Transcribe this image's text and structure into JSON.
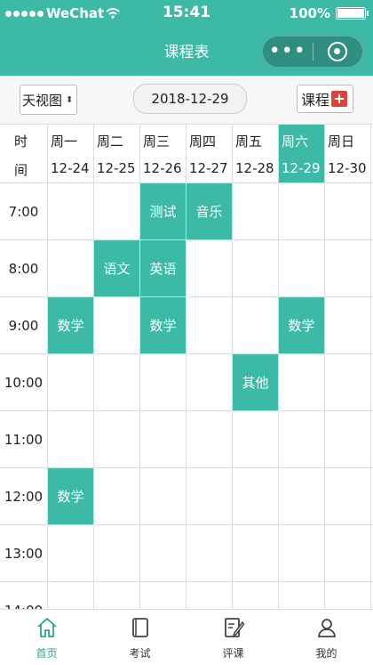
{
  "status": {
    "carrier": "WeChat",
    "time": "15:41",
    "battery": "100%"
  },
  "nav": {
    "title": "课程表"
  },
  "toolbar": {
    "view": "天视图",
    "date": "2018-12-29",
    "course_btn": "课程"
  },
  "time_header": [
    "时",
    "间"
  ],
  "days": [
    {
      "name": "周一",
      "date": "12-24",
      "selected": false
    },
    {
      "name": "周二",
      "date": "12-25",
      "selected": false
    },
    {
      "name": "周三",
      "date": "12-26",
      "selected": false
    },
    {
      "name": "周四",
      "date": "12-27",
      "selected": false
    },
    {
      "name": "周五",
      "date": "12-28",
      "selected": false
    },
    {
      "name": "周六",
      "date": "12-29",
      "selected": true
    },
    {
      "name": "周日",
      "date": "12-30",
      "selected": false
    }
  ],
  "times": [
    "7:00",
    "8:00",
    "9:00",
    "10:00",
    "11:00",
    "12:00",
    "13:00",
    "14:00"
  ],
  "classes": [
    {
      "name": "测试",
      "day": 2,
      "slot": 0
    },
    {
      "name": "音乐",
      "day": 3,
      "slot": 0
    },
    {
      "name": "语文",
      "day": 1,
      "slot": 1
    },
    {
      "name": "英语",
      "day": 2,
      "slot": 1
    },
    {
      "name": "数学",
      "day": 0,
      "slot": 2
    },
    {
      "name": "数学",
      "day": 2,
      "slot": 2
    },
    {
      "name": "数学",
      "day": 5,
      "slot": 2
    },
    {
      "name": "其他",
      "day": 4,
      "slot": 3
    },
    {
      "name": "数学",
      "day": 0,
      "slot": 5
    }
  ],
  "tabs": [
    {
      "label": "首页",
      "icon": "home-icon",
      "active": true
    },
    {
      "label": "考试",
      "icon": "notebook-icon",
      "active": false
    },
    {
      "label": "评课",
      "icon": "edit-document-icon",
      "active": false
    },
    {
      "label": "我的",
      "icon": "user-icon",
      "active": false
    }
  ],
  "colors": {
    "accent": "#3cbaa6",
    "plus": "#d9453a"
  }
}
